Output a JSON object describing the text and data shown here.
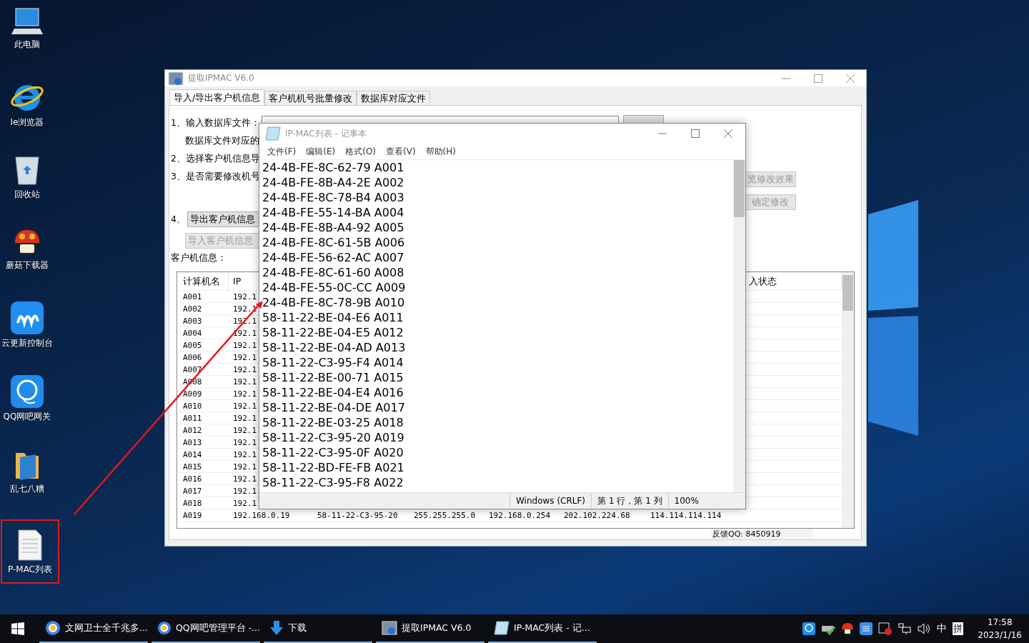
{
  "desktop_icons": [
    {
      "label": "此电脑",
      "kind": "computer",
      "highlighted": false
    },
    {
      "label": "Ie浏览器",
      "kind": "browser",
      "highlighted": false
    },
    {
      "label": "回收站",
      "kind": "bin",
      "highlighted": false
    },
    {
      "label": "蘑菇下载器",
      "kind": "mushroom",
      "highlighted": false
    },
    {
      "label": "云更新控制台",
      "kind": "cloud",
      "highlighted": false
    },
    {
      "label": "QQ网吧网关",
      "kind": "qq",
      "highlighted": false
    },
    {
      "label": "乱七八糟",
      "kind": "folder",
      "highlighted": false
    },
    {
      "label": "P-MAC列表",
      "kind": "document",
      "highlighted": true
    }
  ],
  "main_window": {
    "title": "提取IPMAC V6.0",
    "tabs": [
      {
        "label": "导入/导出客户机信息",
        "selected": true
      },
      {
        "label": "客户机机号批量修改",
        "selected": false
      },
      {
        "label": "数据库对应文件",
        "selected": false
      }
    ],
    "step_1_label": "1、输入数据库文件：",
    "db_note": "数据库文件对应的",
    "step_2_label": "2、选择客户机信息导",
    "step_3_label": "3、是否需要修改机号",
    "step_4_label": "4、",
    "export_button": {
      "label": "导出客户机信息",
      "disabled": false
    },
    "import_button": {
      "label": "导入客户机信息",
      "disabled": true
    },
    "preview_button": {
      "label": "览修改效果",
      "disabled": true
    },
    "confirm_button": {
      "label": "确定修改",
      "disabled": true
    },
    "client_info_label": "客户机信息：",
    "table": {
      "columns": [
        "计算机名",
        "IP"
      ],
      "column_8": "入状态",
      "rows": [
        [
          "A001",
          "192.1"
        ],
        [
          "A002",
          "192.1"
        ],
        [
          "A003",
          "192.1"
        ],
        [
          "A004",
          "192.1"
        ],
        [
          "A005",
          "192.1"
        ],
        [
          "A006",
          "192.1"
        ],
        [
          "A007",
          "192.1"
        ],
        [
          "A008",
          "192.1"
        ],
        [
          "A009",
          "192.1"
        ],
        [
          "A010",
          "192.1"
        ],
        [
          "A011",
          "192.1"
        ],
        [
          "A012",
          "192.1"
        ],
        [
          "A013",
          "192.1"
        ],
        [
          "A014",
          "192.1"
        ],
        [
          "A015",
          "192.1"
        ],
        [
          "A016",
          "192.1"
        ],
        [
          "A017",
          "192.1"
        ],
        [
          "A018",
          "192.1"
        ],
        [
          "A019",
          "192.168.0.19",
          "58-11-22-C3-95-20",
          "255.255.255.0",
          "192.168.0.254",
          "202.102.224.68",
          "114.114.114.114"
        ]
      ]
    },
    "status": "反馈QQ: 8450919"
  },
  "notepad": {
    "title": "IP-MAC列表 - 记事本",
    "menu": [
      "文件(F)",
      "编辑(E)",
      "格式(O)",
      "查看(V)",
      "帮助(H)"
    ],
    "lines": [
      "24-4B-FE-8C-62-79 A001",
      "24-4B-FE-8B-A4-2E A002",
      "24-4B-FE-8C-78-B4 A003",
      "24-4B-FE-55-14-BA A004",
      "24-4B-FE-8B-A4-92 A005",
      "24-4B-FE-8C-61-5B A006",
      "24-4B-FE-56-62-AC A007",
      "24-4B-FE-8C-61-60 A008",
      "24-4B-FE-55-0C-CC A009",
      "24-4B-FE-8C-78-9B A010",
      "58-11-22-BE-04-E6 A011",
      "58-11-22-BE-04-E5 A012",
      "58-11-22-BE-04-AD A013",
      "58-11-22-C3-95-F4 A014",
      "58-11-22-BE-00-71 A015",
      "58-11-22-BE-04-E4 A016",
      "58-11-22-BE-04-DE A017",
      "58-11-22-BE-03-25 A018",
      "58-11-22-C3-95-20 A019",
      "58-11-22-C3-95-0F A020",
      "58-11-22-BD-FE-FB A021",
      "58-11-22-C3-95-F8 A022"
    ],
    "status": [
      "Windows (CRLF)",
      "第 1 行，第 1 列",
      "100%"
    ]
  },
  "taskbar": {
    "items": [
      {
        "label": "文网卫士全千兆多...",
        "kind": "browser"
      },
      {
        "label": "QQ网吧管理平台 -...",
        "kind": "browser"
      },
      {
        "label": "下载",
        "kind": "download"
      },
      {
        "label": "提取IPMAC V6.0",
        "kind": "app"
      },
      {
        "label": "IP-MAC列表 - 记...",
        "kind": "notepad"
      }
    ],
    "input_mode": "中",
    "ime": "拼",
    "time": "17:58",
    "date": "2023/1/16"
  }
}
